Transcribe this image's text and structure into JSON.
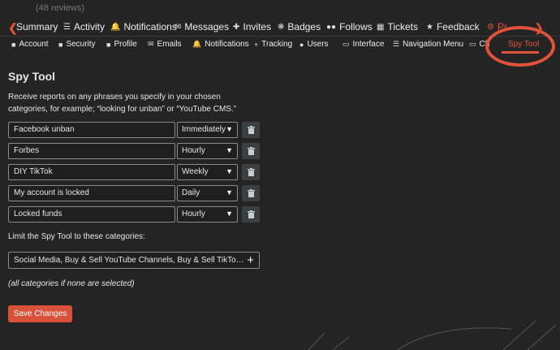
{
  "reviews_text": "(48 reviews)",
  "main_nav": {
    "items": [
      {
        "label": "Summary",
        "icon": "chevron-left-icon"
      },
      {
        "label": "Activity",
        "icon": "list-icon"
      },
      {
        "label": "Notifications",
        "icon": "bell-icon"
      },
      {
        "label": "Messages",
        "icon": "envelope-icon"
      },
      {
        "label": "Invites",
        "icon": "user-plus-icon"
      },
      {
        "label": "Badges",
        "icon": "gear-badge-icon"
      },
      {
        "label": "Follows",
        "icon": "users-icon"
      },
      {
        "label": "Tickets",
        "icon": "ticket-icon"
      },
      {
        "label": "Feedback",
        "icon": "star-icon"
      },
      {
        "label": "Pr",
        "icon": "gear-icon"
      }
    ]
  },
  "sub_nav": {
    "items": [
      {
        "label": "Account",
        "icon": "user-icon"
      },
      {
        "label": "Security",
        "icon": "lock-icon"
      },
      {
        "label": "Profile",
        "icon": "id-card-icon"
      },
      {
        "label": "Emails",
        "icon": "envelope-icon"
      },
      {
        "label": "Notifications",
        "icon": "bell-icon"
      },
      {
        "label": "Tracking",
        "icon": "plus-icon"
      },
      {
        "label": "Users",
        "icon": "users-icon"
      },
      {
        "label": "Interface",
        "icon": "monitor-icon"
      },
      {
        "label": "Navigation Menu",
        "icon": "menu-icon"
      },
      {
        "label": "Ch",
        "icon": "chat-icon"
      },
      {
        "label": "Spy Tool",
        "icon": ""
      }
    ]
  },
  "page": {
    "title": "Spy Tool",
    "description": "Receive reports on any phrases you specify in your chosen categories, for example; “looking for unban” or “YouTube CMS.”",
    "phrases": [
      {
        "phrase": "Facebook unban",
        "frequency": "Immediately"
      },
      {
        "phrase": "Forbes",
        "frequency": "Hourly"
      },
      {
        "phrase": "DIY TikTok",
        "frequency": "Weekly"
      },
      {
        "phrase": "My account is locked",
        "frequency": "Daily"
      },
      {
        "phrase": "Locked funds",
        "frequency": "Hourly"
      }
    ],
    "categories_label": "Limit the Spy Tool to these categories:",
    "categories_value": "Social Media, Buy & Sell YouTube Channels, Buy & Sell TikTo…",
    "categories_note": "(all categories if none are selected)",
    "save_label": "Save Changes"
  },
  "colors": {
    "accent": "#e0523a",
    "background": "#242424",
    "button": "#d9513a"
  }
}
